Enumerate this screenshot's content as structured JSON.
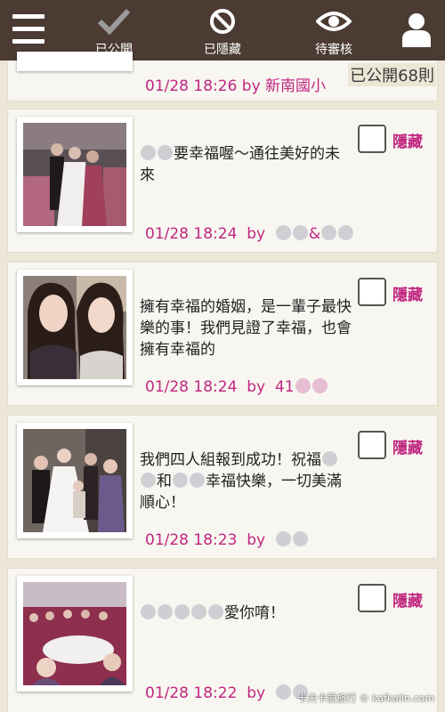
{
  "tabs": [
    {
      "label": "已公開",
      "icon": "checkmark-icon"
    },
    {
      "label": "已隱藏",
      "icon": "prohibit-icon"
    },
    {
      "label": "待審核",
      "icon": "eye-icon"
    }
  ],
  "count_label": "已公開68則",
  "partial_card": {
    "meta": "01/28 18:26  by  新南國小"
  },
  "posts": [
    {
      "message": "要幸福喔～通往美好的未來",
      "time": "01/28 18:24",
      "by": "by",
      "author": "&",
      "hide_label": "隱藏"
    },
    {
      "message": "擁有幸福的婚姻，是一輩子最快樂的事！我們見證了幸福，也會擁有幸福的",
      "time": "01/28 18:24",
      "by": "by",
      "author": "41",
      "hide_label": "隱藏"
    },
    {
      "message_part1": "我們四人組報到成功！祝福",
      "message_part2": "和",
      "message_part3": "幸福快樂，一切美滿順心！",
      "time": "01/28 18:23",
      "by": "by",
      "author": "",
      "hide_label": "隱藏"
    },
    {
      "message": "愛你唷！",
      "time": "01/28 18:22",
      "by": "by",
      "author": "",
      "hide_label": "隱藏"
    }
  ],
  "watermark": "卡夫卡愛旅行 © kafkalin.com",
  "colors": {
    "topbar": "#4b3b33",
    "accent": "#c0267f",
    "background": "#ece6d6",
    "card": "#f8f6f1"
  }
}
